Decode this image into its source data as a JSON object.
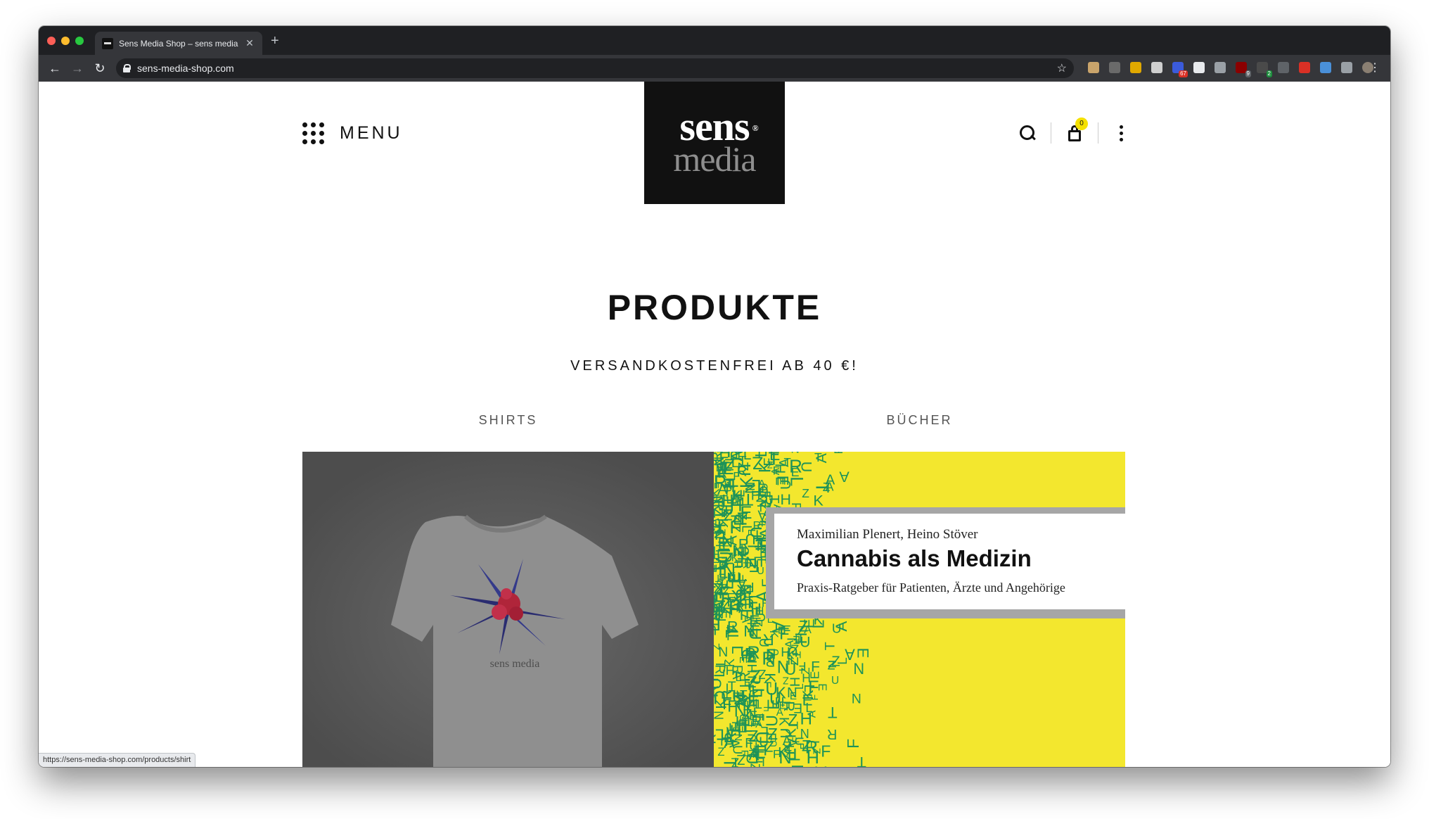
{
  "browser": {
    "tab_title": "Sens Media Shop – sens media",
    "tab_close": "✕",
    "new_tab": "+",
    "url": "sens-media-shop.com",
    "back": "←",
    "forward": "→",
    "reload": "↻",
    "bookmark_star": "☆",
    "menu": "⋮",
    "status_url": "https://sens-media-shop.com/products/shirt",
    "extensions": [
      {
        "name": "extension-1-icon",
        "color": "#c9a46b",
        "badge": ""
      },
      {
        "name": "extension-2-icon",
        "color": "#6a6a6a",
        "badge": ""
      },
      {
        "name": "extension-3-icon",
        "color": "#e0a800",
        "badge": ""
      },
      {
        "name": "extension-4-icon",
        "color": "#cfcfcf",
        "badge": ""
      },
      {
        "name": "extension-5-icon",
        "color": "#3b5bdb",
        "badge": "67",
        "badge_color": "#d93025"
      },
      {
        "name": "extension-6-icon",
        "color": "#e8eaed",
        "badge": ""
      },
      {
        "name": "extension-7-icon",
        "color": "#9aa0a6",
        "badge": ""
      },
      {
        "name": "extension-8-icon",
        "color": "#8b0000",
        "badge": "9",
        "badge_color": "#5f6368"
      },
      {
        "name": "extension-9-icon",
        "color": "#4a4a4a",
        "badge": "2",
        "badge_color": "#1e8e3e"
      },
      {
        "name": "extension-10-icon",
        "color": "#5f6368",
        "badge": ""
      },
      {
        "name": "extension-11-icon",
        "color": "#d93025",
        "badge": ""
      },
      {
        "name": "extension-12-icon",
        "color": "#4a90d9",
        "badge": ""
      },
      {
        "name": "extension-13-icon",
        "color": "#9aa0a6",
        "badge": ""
      },
      {
        "name": "profile-avatar-icon",
        "color": "#8a7f72",
        "badge": ""
      }
    ]
  },
  "header": {
    "menu_label": "MENU",
    "logo_top": "sens",
    "logo_reg": "®",
    "logo_bottom": "media",
    "cart_count": "0"
  },
  "main": {
    "title": "PRODUKTE",
    "subtitle": "VERSANDKOSTENFREI AB 40 €!",
    "categories": [
      {
        "label": "SHIRTS"
      },
      {
        "label": "BÜCHER"
      }
    ],
    "shirt_print": "sens media",
    "book": {
      "authors": "Maximilian Plenert, Heino Stöver",
      "title": "Cannabis als Medizin",
      "subtitle": "Praxis-Ratgeber für Patienten, Ärzte und Angehörige"
    }
  },
  "colors": {
    "book_yellow": "#f3e72e",
    "book_green": "#1e9358",
    "cart_badge": "#f5e100"
  }
}
